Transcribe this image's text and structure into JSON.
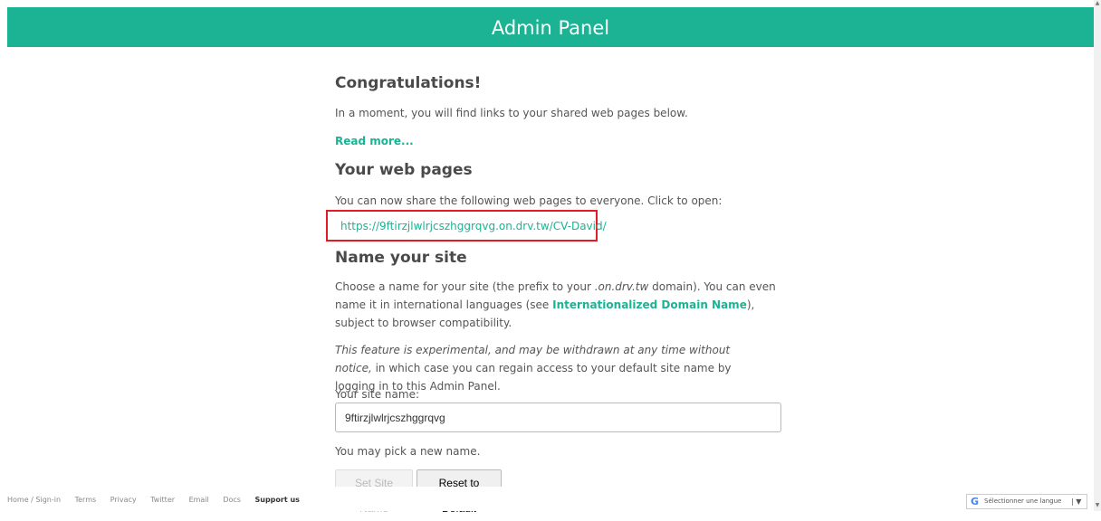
{
  "header": {
    "title": "Admin Panel"
  },
  "congrats": {
    "title": "Congratulations!",
    "text": "In a moment, you will find links to your shared web pages below.",
    "read_more": "Read more..."
  },
  "web_pages": {
    "title": "Your web pages",
    "text": "You can now share the following web pages to everyone. Click to open:",
    "link": "https://9ftirzjlwlrjcszhggrqvg.on.drv.tw/CV-David/"
  },
  "name_site": {
    "title": "Name your site",
    "p1_a": "Choose a name for your site (the prefix to your ",
    "p1_domain": ".on.drv.tw",
    "p1_b": " domain). You can even name it in international languages (see ",
    "p1_link": "Internationalized Domain Name",
    "p1_c": "), subject to browser compatibility.",
    "p2_italic": "This feature is experimental, and may be withdrawn at any time without notice,",
    "p2_rest": " in which case you can regain access to your default site name by logging in to this Admin Panel.",
    "label": "Your site name:",
    "input_value": "9ftirzjlwlrjcszhggrqvg",
    "hint": "You may pick a new name.",
    "set_button": "Set Site Name",
    "reset_button": "Reset to Default"
  },
  "footer": {
    "links": [
      "Home / Sign-in",
      "Terms",
      "Privacy",
      "Twitter",
      "Email",
      "Docs"
    ],
    "support": "Support us",
    "language_select": "Sélectionner une langue",
    "google_icon": "G"
  },
  "colors": {
    "accent": "#1bb394",
    "highlight": "#e31b23"
  }
}
